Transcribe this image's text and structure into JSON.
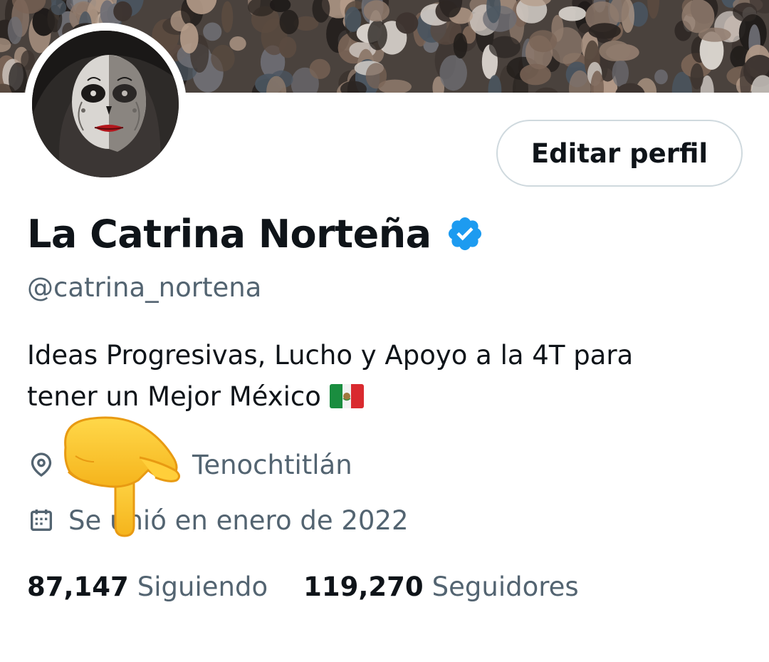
{
  "profile": {
    "display_name": "La Catrina Norteña",
    "handle": "@catrina_nortena",
    "verified_color": "#1d9bf0",
    "bio_line1": "Ideas Progresivas, Lucho y Apoyo a la 4T para",
    "bio_line2": "tener un Mejor México",
    "bio_emoji": "mexico-flag",
    "location": "Tenochtitlán",
    "location_icon": "map-pin-icon",
    "joined": "Se unió en enero de 2022",
    "joined_icon": "calendar-icon"
  },
  "actions": {
    "edit_profile_label": "Editar perfil"
  },
  "stats": {
    "following_count": "87,147",
    "following_label": "Siguiendo",
    "followers_count": "119,270",
    "followers_label": "Seguidores"
  },
  "overlay": {
    "emoji": "backhand-index-pointing-down"
  },
  "colors": {
    "text_primary": "#0f1419",
    "text_secondary": "#536471",
    "border": "#cfd9de",
    "verified": "#1d9bf0"
  }
}
